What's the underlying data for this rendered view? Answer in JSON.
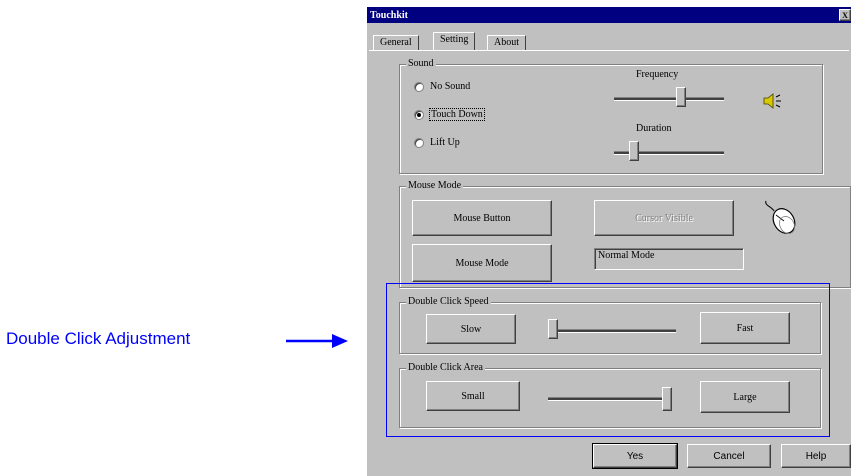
{
  "window": {
    "title": "Touchkit",
    "close_label": "X"
  },
  "tabs": [
    {
      "label": "General"
    },
    {
      "label": "Setting"
    },
    {
      "label": "About"
    }
  ],
  "sound": {
    "group_label": "Sound",
    "options": [
      {
        "label": "No Sound",
        "checked": false
      },
      {
        "label": "Touch Down",
        "checked": true
      },
      {
        "label": "Lift Up",
        "checked": false
      }
    ],
    "frequency_label": "Frequency",
    "frequency_level": 0.62,
    "duration_label": "Duration",
    "duration_level": 0.15,
    "speaker_icon": "speaker-icon"
  },
  "mouse_mode": {
    "group_label": "Mouse Mode",
    "mouse_button_label": "Mouse Button",
    "cursor_visible_label": "Cursor Visible",
    "mouse_mode_button_label": "Mouse Mode",
    "mode_value": "Normal Mode",
    "mouse_icon": "mouse-icon"
  },
  "double_click_speed": {
    "group_label": "Double Click Speed",
    "slow_label": "Slow",
    "fast_label": "Fast",
    "level": 0.0
  },
  "double_click_area": {
    "group_label": "Double Click Area",
    "small_label": "Small",
    "large_label": "Large",
    "level": 1.0
  },
  "footer": {
    "yes_label": "Yes",
    "cancel_label": "Cancel",
    "help_label": "Help"
  },
  "annotation": {
    "label": "Double Click Adjustment",
    "color": "#0000ff"
  }
}
